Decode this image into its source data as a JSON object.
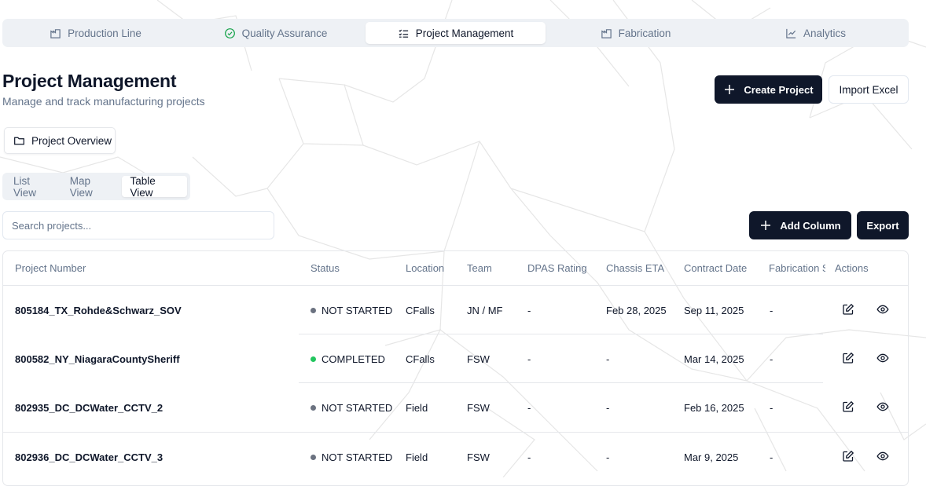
{
  "tabs": [
    {
      "label": "Production Line",
      "icon": "factory-icon"
    },
    {
      "label": "Quality Assurance",
      "icon": "check-circle-icon"
    },
    {
      "label": "Project Management",
      "icon": "list-checks-icon",
      "active": true
    },
    {
      "label": "Fabrication",
      "icon": "factory-icon"
    },
    {
      "label": "Analytics",
      "icon": "line-chart-icon"
    }
  ],
  "page": {
    "title": "Project Management",
    "subtitle": "Manage and track manufacturing projects"
  },
  "actions": {
    "create_project": "Create Project",
    "import_excel": "Import Excel",
    "add_column": "Add Column",
    "export": "Export"
  },
  "overview": {
    "label": "Project Overview"
  },
  "views": [
    "List View",
    "Map View",
    "Table View"
  ],
  "active_view": "Table View",
  "search": {
    "placeholder": "Search projects..."
  },
  "table": {
    "headers": [
      "Project Number",
      "Status",
      "Location",
      "Team",
      "DPAS Rating",
      "Chassis ETA",
      "Contract Date",
      "Fabrication S",
      "Actions"
    ],
    "rows": [
      {
        "project_number": "805184_TX_Rohde&Schwarz_SOV",
        "status": "NOT STARTED",
        "location": "CFalls",
        "team": "JN / MF",
        "dpas": "-",
        "chassis_eta": "Feb 28, 2025",
        "contract_date": "Sep 11, 2025",
        "fabrication": "-"
      },
      {
        "project_number": "800582_NY_NiagaraCountySheriff",
        "status": "COMPLETED",
        "location": "CFalls",
        "team": "FSW",
        "dpas": "-",
        "chassis_eta": "-",
        "contract_date": "Mar 14, 2025",
        "fabrication": "-"
      },
      {
        "project_number": "802935_DC_DCWater_CCTV_2",
        "status": "NOT STARTED",
        "location": "Field",
        "team": "FSW",
        "dpas": "-",
        "chassis_eta": "-",
        "contract_date": "Feb 16, 2025",
        "fabrication": "-"
      },
      {
        "project_number": "802936_DC_DCWater_CCTV_3",
        "status": "NOT STARTED",
        "location": "Field",
        "team": "FSW",
        "dpas": "-",
        "chassis_eta": "-",
        "contract_date": "Mar 9, 2025",
        "fabrication": "-"
      }
    ]
  },
  "colors": {
    "primary": "#0f172a",
    "muted_text": "#64748b",
    "status_completed": "#22c55e",
    "status_not_started": "#6b7280",
    "tab_bg": "#eef1f5"
  }
}
